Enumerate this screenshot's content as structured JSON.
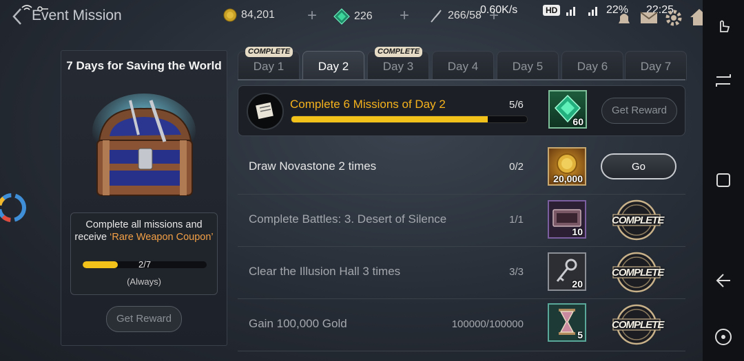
{
  "header": {
    "title": "Event Mission",
    "gold": "84,201",
    "gems": "226",
    "stamina": "266/58"
  },
  "status_bar": {
    "speed": "0.60K/s",
    "hd": "HD",
    "battery": "22%",
    "time": "22:25"
  },
  "left_panel": {
    "title": "7 Days for Saving the World",
    "desc_line1": "Complete all missions and",
    "desc_line2_prefix": "receive ",
    "desc_highlight": "‘Rare Weapon Coupon’",
    "progress_text": "2/7",
    "progress_value": 0.2857,
    "note": "(Always)",
    "reward_button": "Get Reward"
  },
  "tabs": [
    {
      "label": "Day 1",
      "badge": "COMPLETE"
    },
    {
      "label": "Day 2",
      "badge": ""
    },
    {
      "label": "Day 3",
      "badge": "COMPLETE"
    },
    {
      "label": "Day 4",
      "badge": ""
    },
    {
      "label": "Day 5",
      "badge": ""
    },
    {
      "label": "Day 6",
      "badge": ""
    },
    {
      "label": "Day 7",
      "badge": ""
    }
  ],
  "main_mission": {
    "title": "Complete 6 Missions of Day 2",
    "count": "5/6",
    "progress_value": 0.8333,
    "reward_qty": "60",
    "button": "Get Reward"
  },
  "missions": [
    {
      "text": "Draw Novastone 2 times",
      "count": "0/2",
      "reward_qty": "20,000",
      "button": "Go",
      "state": "go"
    },
    {
      "text": "Complete Battles: 3. Desert of Silence",
      "count": "1/1",
      "reward_qty": "10",
      "button": "COMPLETE",
      "state": "complete"
    },
    {
      "text": "Clear the Illusion Hall 3 times",
      "count": "3/3",
      "reward_qty": "20",
      "button": "COMPLETE",
      "state": "complete"
    },
    {
      "text": "Gain 100,000 Gold",
      "count": "100000/100000",
      "reward_qty": "5",
      "button": "COMPLETE",
      "state": "complete"
    }
  ],
  "colors": {
    "accent_yellow": "#f2c21b",
    "mission_title": "#f6b21c",
    "highlight_orange": "#f3a046"
  }
}
